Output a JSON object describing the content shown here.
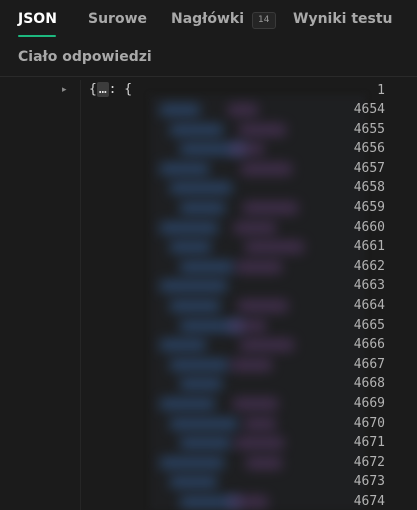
{
  "tabs": [
    {
      "label": "JSON",
      "active": true
    },
    {
      "label": "Surowe",
      "active": false
    },
    {
      "label": "Nagłówki",
      "badge": "14",
      "active": false
    },
    {
      "label": "Wyniki testu",
      "active": false
    }
  ],
  "subheader": "Ciało odpowiedzi",
  "editor": {
    "first_line_number": "1",
    "first_line": {
      "open": "{",
      "collapsed": "…",
      "rest": ": {"
    },
    "line_numbers": [
      "4654",
      "4655",
      "4656",
      "4657",
      "4658",
      "4659",
      "4660",
      "4661",
      "4662",
      "4663",
      "4664",
      "4665",
      "4666",
      "4667",
      "4668",
      "4669",
      "4670",
      "4671",
      "4672",
      "4673",
      "4674"
    ]
  },
  "colors": {
    "accent": "#1db87f",
    "background": "#1b1b1b",
    "key_blur": "#2f4f7a",
    "value_blur": "#5a3a6a"
  }
}
